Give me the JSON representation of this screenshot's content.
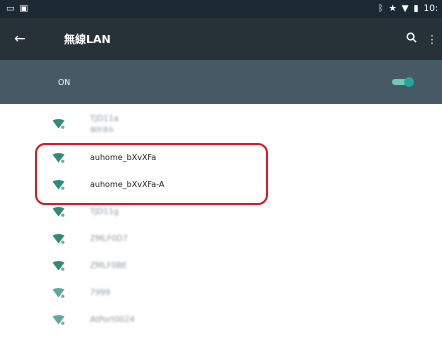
{
  "status_bar": {
    "left_icons": [
      "sim-icon",
      "image-icon"
    ],
    "right_icons": [
      "bluetooth-icon",
      "star-icon",
      "wifi-icon",
      "battery-icon"
    ],
    "time": "10:"
  },
  "app_bar": {
    "back_icon": "arrow-left-icon",
    "title": "無線LAN",
    "search_icon": "search-icon",
    "more_icon": "more-vert-icon"
  },
  "wifi_switch": {
    "label": "ON",
    "state": "on",
    "accent_color": "#26a69a"
  },
  "networks": [
    {
      "ssid": "TJD11a",
      "detail": "保存済み",
      "blurred": true,
      "icon_color": "#2e8b7a"
    },
    {
      "ssid": "auhome_bXvXFa",
      "blurred": false,
      "icon_color": "#2e8b7a"
    },
    {
      "ssid": "auhome_bXvXFa-A",
      "blurred": false,
      "icon_color": "#2e8b7a"
    },
    {
      "ssid": "TJD11g",
      "blurred": true,
      "icon_color": "#2e8b7a"
    },
    {
      "ssid": "ZMLF0D7",
      "blurred": true,
      "icon_color": "#2e8b7a"
    },
    {
      "ssid": "ZMLF0BE",
      "blurred": true,
      "icon_color": "#2e8b7a"
    },
    {
      "ssid": "7999",
      "blurred": true,
      "icon_color": "#5fa8a0"
    },
    {
      "ssid": "AtPort0024",
      "blurred": true,
      "icon_color": "#5fa8a0"
    }
  ],
  "highlight_color": "#e01523"
}
